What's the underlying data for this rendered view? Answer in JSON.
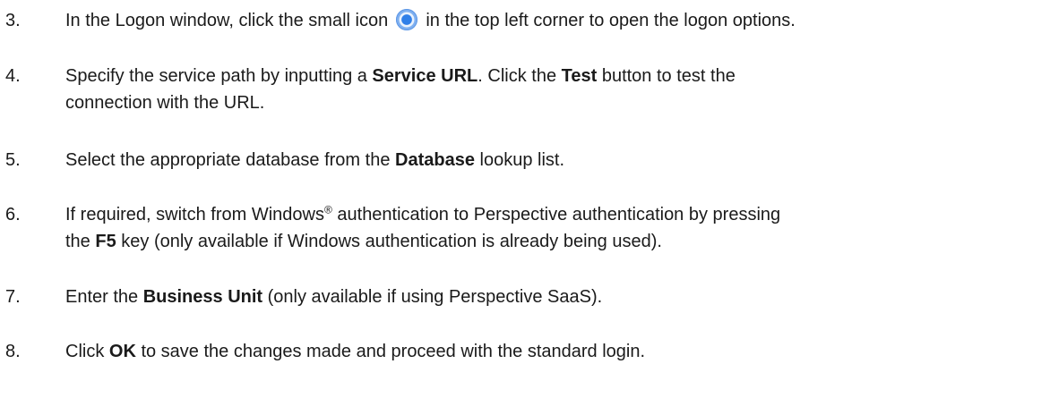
{
  "steps": [
    {
      "number": "3.",
      "part1": "In the Logon window, click the small icon ",
      "icon": "logon-options-icon",
      "part2": " in the top left corner to open the logon options."
    },
    {
      "number": "4.",
      "part1": "Specify the service path by inputting a ",
      "bold1": "Service URL",
      "part2": ". Click the ",
      "bold2": "Test",
      "part3": " button to test the",
      "line2": "connection with the URL."
    },
    {
      "number": "5.",
      "part1": "Select the appropriate database from the ",
      "bold1": "Database",
      "part2": " lookup list."
    },
    {
      "number": "6.",
      "part1": "If required, switch from Windows",
      "sup": "®",
      "part2": " authentication to Perspective authentication by pressing",
      "line2_part1": "the ",
      "bold1": "F5",
      "line2_part2": " key (only available if Windows authentication is already being used)."
    },
    {
      "number": "7.",
      "part1": "Enter the ",
      "bold1": "Business Unit",
      "part2": " (only available if using Perspective SaaS)."
    },
    {
      "number": "8.",
      "part1": "Click ",
      "bold1": "OK",
      "part2": " to save the changes made and proceed with the standard login."
    }
  ]
}
